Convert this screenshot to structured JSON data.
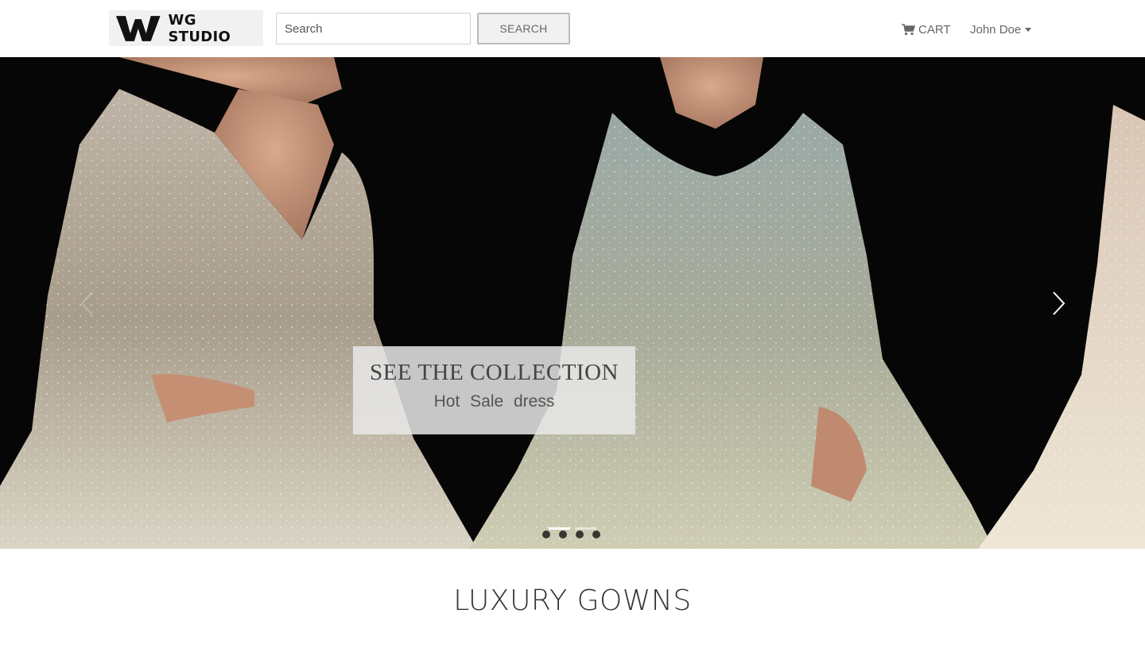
{
  "navbar": {
    "brand_text": "WG STUDIO",
    "brand_mark": "W",
    "search_placeholder": "Search",
    "search_button": "SEARCH",
    "cart_label": "CART",
    "user_name": "John Doe"
  },
  "carousel": {
    "caption_title": "SEE THE COLLECTION",
    "caption_subtitle": "Hot Sale dress",
    "prev_icon": "chevron-left-icon",
    "next_icon": "chevron-right-icon",
    "slide_count": 4,
    "active_slide": 1
  },
  "section": {
    "title": "LUXURY GOWNS"
  },
  "colors": {
    "background": "#ffffff",
    "text": "#333333",
    "muted": "#666666",
    "caption_bg": "#e8e8e8"
  }
}
